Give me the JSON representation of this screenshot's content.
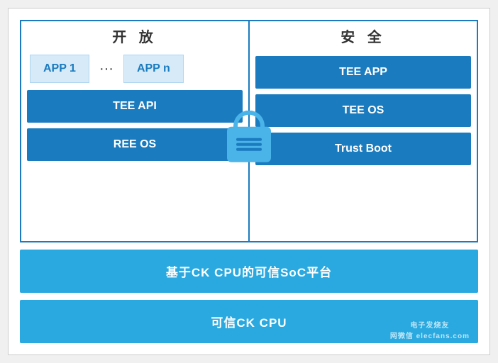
{
  "diagram": {
    "left_title": "开 放",
    "right_title": "安 全",
    "app1": "APP 1",
    "app_dots": "···",
    "app_n": "APP n",
    "tee_api": "TEE API",
    "ree_os": "REE OS",
    "tee_app": "TEE APP",
    "tee_os": "TEE OS",
    "trust_boot": "Trust Boot",
    "soc_platform": "基于CK CPU的可信SoC平台",
    "cpu_platform": "可信CK CPU",
    "watermark": "电子发烧友\n网微信 elecfans.com"
  }
}
